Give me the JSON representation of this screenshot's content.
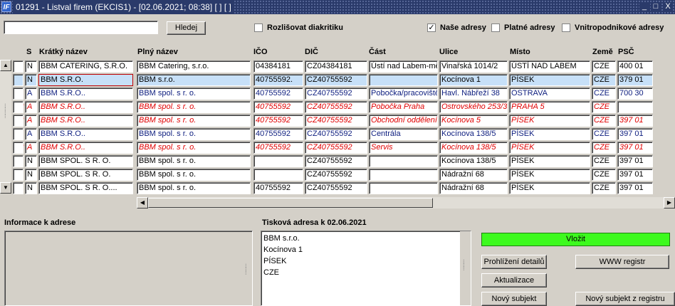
{
  "window": {
    "icon_text": "IF",
    "title": "01291 - Listval firem (EKCIS1) - [02.06.2021; 08:38]  [ ]  [ ]",
    "minimize": "_",
    "maximize": "□",
    "close": "X"
  },
  "search": {
    "value": "",
    "button_label": "Hledej",
    "diacritics_label": "Rozlišovat diakritiku",
    "diacritics_checked": false
  },
  "filters": {
    "nase_label": "Naše adresy",
    "nase_checked": true,
    "platne_label": "Platné adresy",
    "platne_checked": false,
    "vnitro_label": "Vnitropodnikové adresy",
    "vnitro_checked": false
  },
  "table": {
    "headers": [
      "S",
      "Krátký název",
      "Plný název",
      "IČO",
      "DIČ",
      "Část",
      "Ulice",
      "Místo",
      "Země",
      "PSČ"
    ],
    "rows": [
      {
        "mark": "",
        "style": "normal",
        "s": "N",
        "kratky": "BBM CATERING, S.R.O.",
        "plny": "BBM Catering, s.r.o.",
        "ico": "04384181",
        "dic": "CZ04384181",
        "cast": "Ústí nad Labem-městc",
        "ulice": "Vinařská 1014/2",
        "misto": "ÚSTÍ NAD LABEM",
        "zeme": "CZE",
        "psc": "400 01"
      },
      {
        "mark": "",
        "style": "selected",
        "s": "N",
        "kratky": "BBM S.R.O.",
        "plny": "BBM s.r.o.",
        "ico": "40755592.",
        "dic": "CZ40755592",
        "cast": "",
        "ulice": "Kocínova 1",
        "misto": "PÍSEK",
        "zeme": "CZE",
        "psc": "379 01"
      },
      {
        "mark": "",
        "style": "blue",
        "s": "A",
        "kratky": "BBM S.R.O..",
        "plny": "BBM spol. s r. o.",
        "ico": "40755592",
        "dic": "CZ40755592",
        "cast": "Pobočka/pracoviště",
        "ulice": "Havl. Nábřeží 38",
        "misto": "OSTRAVA",
        "zeme": "CZE",
        "psc": "700 30"
      },
      {
        "mark": "*",
        "style": "red",
        "s": "A",
        "kratky": "BBM S.R.O..",
        "plny": "BBM spol. s r. o.",
        "ico": "40755592",
        "dic": "CZ40755592",
        "cast": "Pobočka Praha",
        "ulice": "Ostrovského 253/3",
        "misto": "PRAHA 5",
        "zeme": "CZE",
        "psc": ""
      },
      {
        "mark": "*",
        "style": "red",
        "s": "A",
        "kratky": "BBM S.R.O..",
        "plny": "BBM spol. s r. o.",
        "ico": "40755592",
        "dic": "CZ40755592",
        "cast": "Obchodní oddělení",
        "ulice": "Kocínova 5",
        "misto": "PÍSEK",
        "zeme": "CZE",
        "psc": "397 01"
      },
      {
        "mark": "",
        "style": "blue",
        "s": "A",
        "kratky": "BBM S.R.O..",
        "plny": "BBM spol. s r. o.",
        "ico": "40755592",
        "dic": "CZ40755592",
        "cast": "Centrála",
        "ulice": "Kocínova 138/5",
        "misto": "PÍSEK",
        "zeme": "CZE",
        "psc": "397 01"
      },
      {
        "mark": "*",
        "style": "red",
        "s": "A",
        "kratky": "BBM S.R.O..",
        "plny": "BBM spol. s r. o.",
        "ico": "40755592",
        "dic": "CZ40755592",
        "cast": "Servis",
        "ulice": "Kocínova 138/5",
        "misto": "PÍSEK",
        "zeme": "CZE",
        "psc": "397 01"
      },
      {
        "mark": "",
        "style": "normal",
        "s": "N",
        "kratky": "BBM SPOL. S R. O.",
        "plny": "BBM spol. s r. o.",
        "ico": "",
        "dic": "CZ40755592",
        "cast": "",
        "ulice": "Kocínova 138/5",
        "misto": "PÍSEK",
        "zeme": "CZE",
        "psc": "397 01"
      },
      {
        "mark": "",
        "style": "normal",
        "s": "N",
        "kratky": "BBM SPOL. S R. O.",
        "plny": "BBM spol. s r. o.",
        "ico": "",
        "dic": "CZ40755592",
        "cast": "",
        "ulice": "Nádražní 68",
        "misto": "PÍSEK",
        "zeme": "CZE",
        "psc": "397 01"
      },
      {
        "mark": "",
        "style": "normal",
        "s": "N",
        "kratky": "BBM SPOL. S R. O....",
        "plny": "BBM spol. s r. o.",
        "ico": "40755592",
        "dic": "CZ40755592",
        "cast": "",
        "ulice": "Nádražní 68",
        "misto": "PÍSEK",
        "zeme": "CZE",
        "psc": "397 01"
      }
    ]
  },
  "info": {
    "label": "Informace k adrese"
  },
  "print_address": {
    "label": "Tisková adresa k 02.06.2021",
    "lines": [
      "BBM s.r.o.",
      "Kocínova 1",
      "PÍSEK",
      "CZE"
    ]
  },
  "actions": {
    "insert": "Vložit",
    "details": "Prohlížení detailů",
    "www": "WWW registr",
    "update": "Aktualizace",
    "new_subject": "Nový subjekt",
    "new_from_registry": "Nový subjekt z registru"
  },
  "colors": {
    "title_bg": "#2a3a6a",
    "selected_row": "#c7e0f8",
    "red_row_text": "#e00000",
    "blue_row_text": "#102080",
    "insert_button": "#3dfa1e"
  }
}
